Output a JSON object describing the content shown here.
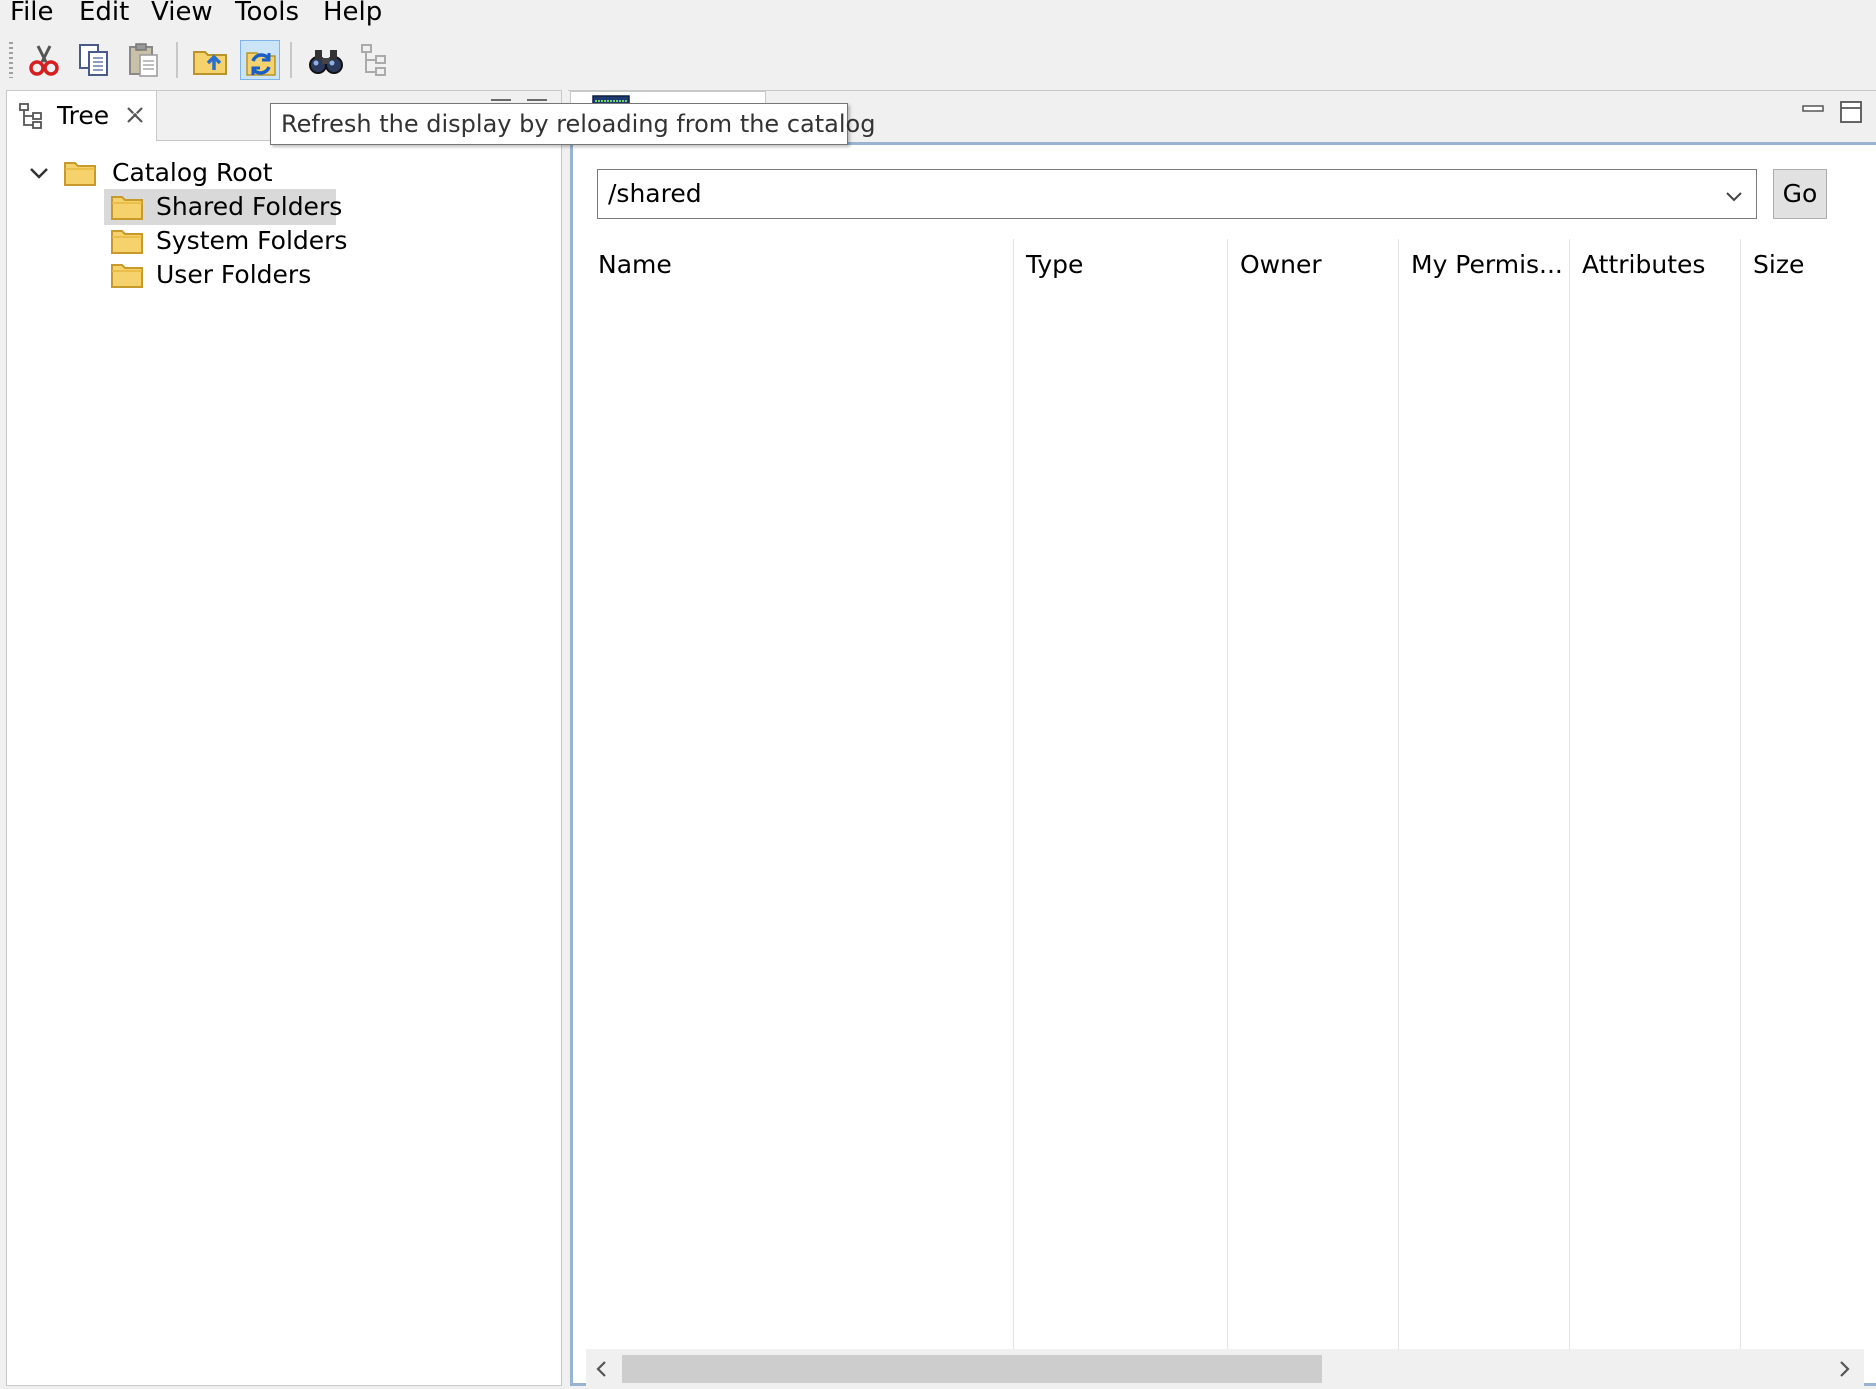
{
  "menu": {
    "items": [
      "File",
      "Edit",
      "View",
      "Tools",
      "Help"
    ]
  },
  "toolbar": {
    "icons": [
      "cut-icon",
      "copy-icon",
      "paste-icon",
      "open-folder-icon",
      "refresh-icon",
      "find-icon",
      "tree-icon"
    ],
    "active": "refresh-icon"
  },
  "tooltip": {
    "text": "Refresh the display by reloading from the catalog"
  },
  "left_pane": {
    "tab_label": "Tree",
    "tree": {
      "root_label": "Catalog Root",
      "children": [
        "Shared Folders",
        "System Folders",
        "User Folders"
      ],
      "selected": "Shared Folders"
    }
  },
  "right_pane": {
    "path_value": "/shared",
    "go_label": "Go",
    "columns": [
      "Name",
      "Type",
      "Owner",
      "My Permis...",
      "Attributes",
      "Size"
    ]
  },
  "colors": {
    "selection": "#d9d9d9",
    "active_toolbar": "#cce4f7",
    "folder_yellow": "#f5d26b",
    "editor_border": "#99b4d1"
  }
}
